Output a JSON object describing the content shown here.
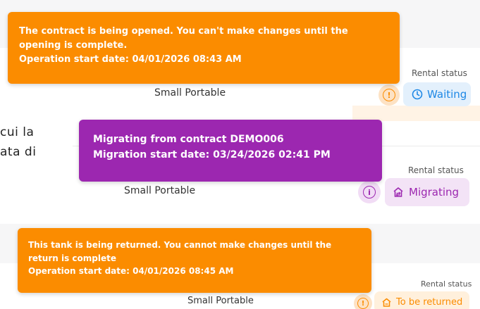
{
  "background_text": {
    "line1": "cui la",
    "line2": "ata di"
  },
  "rows": [
    {
      "rental_status_label": "Rental status",
      "product": "Small Portable",
      "info_icon_glyph": "!",
      "status_label": "Waiting",
      "status_icon": "clock-icon",
      "popover": {
        "line1": "The contract is being opened. You can't make changes until the",
        "line2": "opening is complete.",
        "line3": "Operation start date: 04/01/2026 08:43 AM"
      }
    },
    {
      "rental_status_label": "Rental status",
      "product": "Small Portable",
      "info_icon_glyph": "i",
      "status_label": "Migrating",
      "status_icon": "migrate-icon",
      "popover": {
        "line1": "Migrating from contract DEMO006",
        "line2": "Migration start date: 03/24/2026 02:41 PM"
      }
    },
    {
      "rental_status_label": "Rental status",
      "product": "Small Portable",
      "info_icon_glyph": "!",
      "status_label": "To be returned",
      "status_icon": "home-return-icon",
      "popover": {
        "line1": "This tank is being returned. You cannot make changes until the",
        "line2": "return is complete",
        "line3": "Operation start date: 04/01/2026 08:45 AM"
      }
    }
  ],
  "colors": {
    "orange_popover": "#fb8c00",
    "purple_popover": "#9c27b0",
    "waiting_bg": "#e3f0fc",
    "waiting_fg": "#1e88e5",
    "migrating_bg": "#f3e3f6",
    "migrating_fg": "#9c27b0",
    "returned_bg": "#fff0dc",
    "returned_fg": "#fb8c00"
  }
}
